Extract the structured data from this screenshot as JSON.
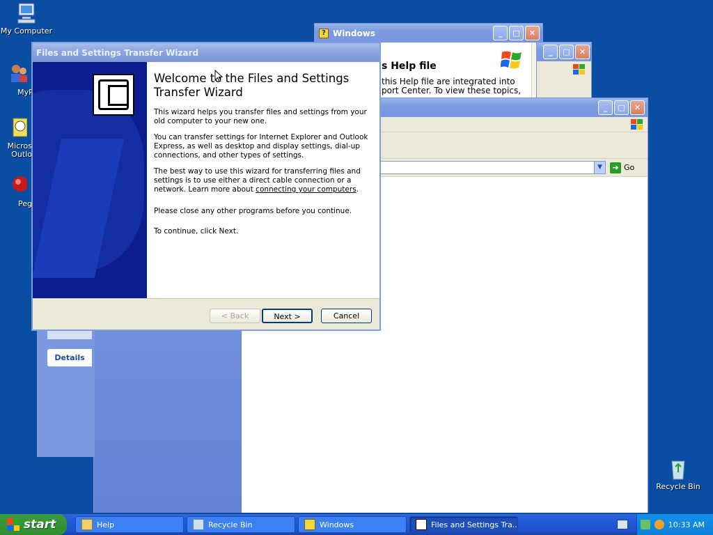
{
  "desktop": {
    "icons": [
      {
        "label": "My Computer"
      },
      {
        "label": "MyPa"
      },
      {
        "label": "Micros\nOutlo"
      },
      {
        "label": "Peg"
      },
      {
        "label": "Recycle Bin"
      }
    ]
  },
  "wizard": {
    "title": "Files and Settings Transfer Wizard",
    "heading": "Welcome to the Files and Settings Transfer Wizard",
    "p1": "This wizard helps you transfer files and settings from your old computer to your new one.",
    "p2": "You can transfer settings for Internet Explorer and Outlook Express, as well as desktop and display settings, dial-up connections, and other types of settings.",
    "p3_before": "The best way to use this wizard for transferring files and settings is to use either a direct cable connection or a network. Learn more about ",
    "p3_link": "connecting your computers",
    "p3_after": ".",
    "p4": "Please close any other programs before you continue.",
    "p5": "To continue, click Next.",
    "back_label": "< Back",
    "next_label": "Next >",
    "cancel_label": "Cancel"
  },
  "help_window": {
    "title": "Windows",
    "heading_partial": "s Help file",
    "line1": "this Help file are integrated into",
    "line2": "port Center. To view these topics,"
  },
  "explorer": {
    "go_label": "Go"
  },
  "details_panel": {
    "label": "Details"
  },
  "taskbar": {
    "start_label": "start",
    "tasks": [
      {
        "label": "Help"
      },
      {
        "label": "Recycle Bin"
      },
      {
        "label": "Windows"
      },
      {
        "label": "Files and Settings Tra..."
      }
    ],
    "clock": "10:33 AM"
  },
  "window_buttons": {
    "minimize": "_",
    "maximize": "□",
    "close": "✕"
  }
}
